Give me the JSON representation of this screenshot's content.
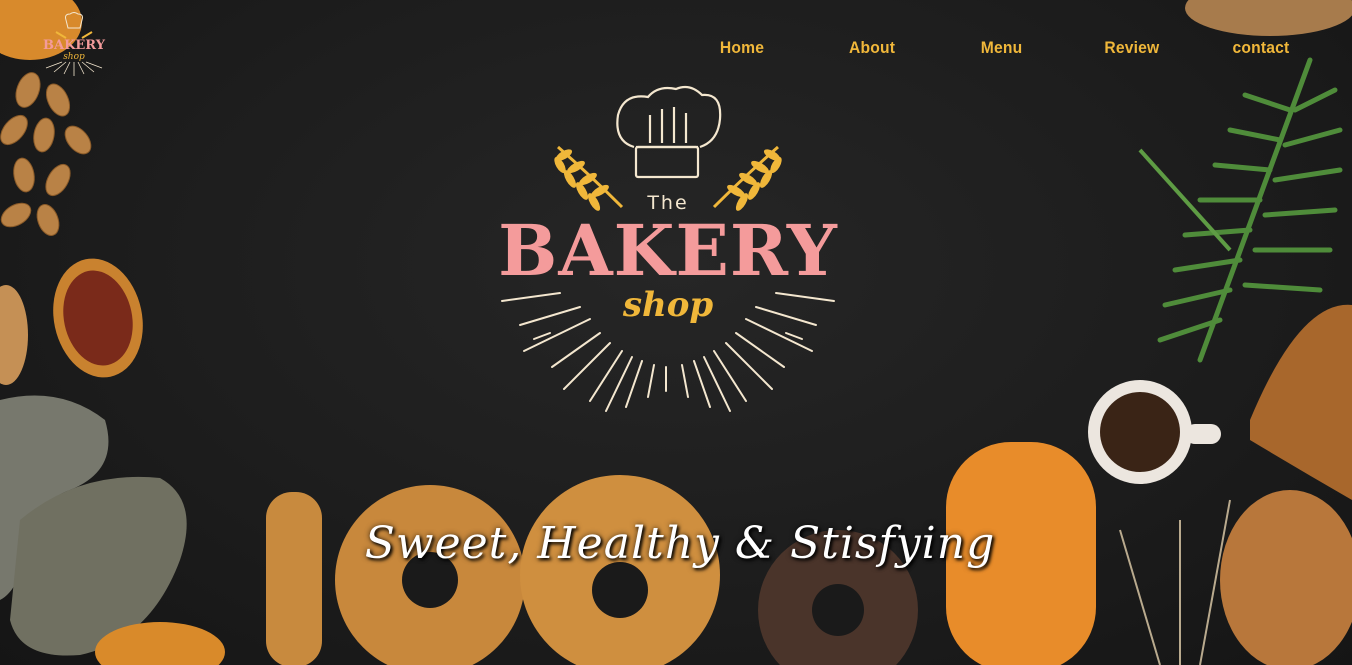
{
  "site": {
    "logo": {
      "the": "The",
      "name": "BAKERY",
      "sub": "shop"
    },
    "mini_logo": {
      "name": "BAKERY",
      "sub": "shop"
    }
  },
  "nav": {
    "items": [
      "Home",
      "About",
      "Menu",
      "Review",
      "contact"
    ]
  },
  "hero": {
    "tagline": "Sweet, Healthy & Stisfying"
  },
  "colors": {
    "accent": "#f0b73a",
    "brand_pink": "#f49b9b",
    "background": "#1d1d1d",
    "cream": "#f4e7cf"
  },
  "icons": [
    "chef-hat-icon",
    "wheat-icon"
  ]
}
